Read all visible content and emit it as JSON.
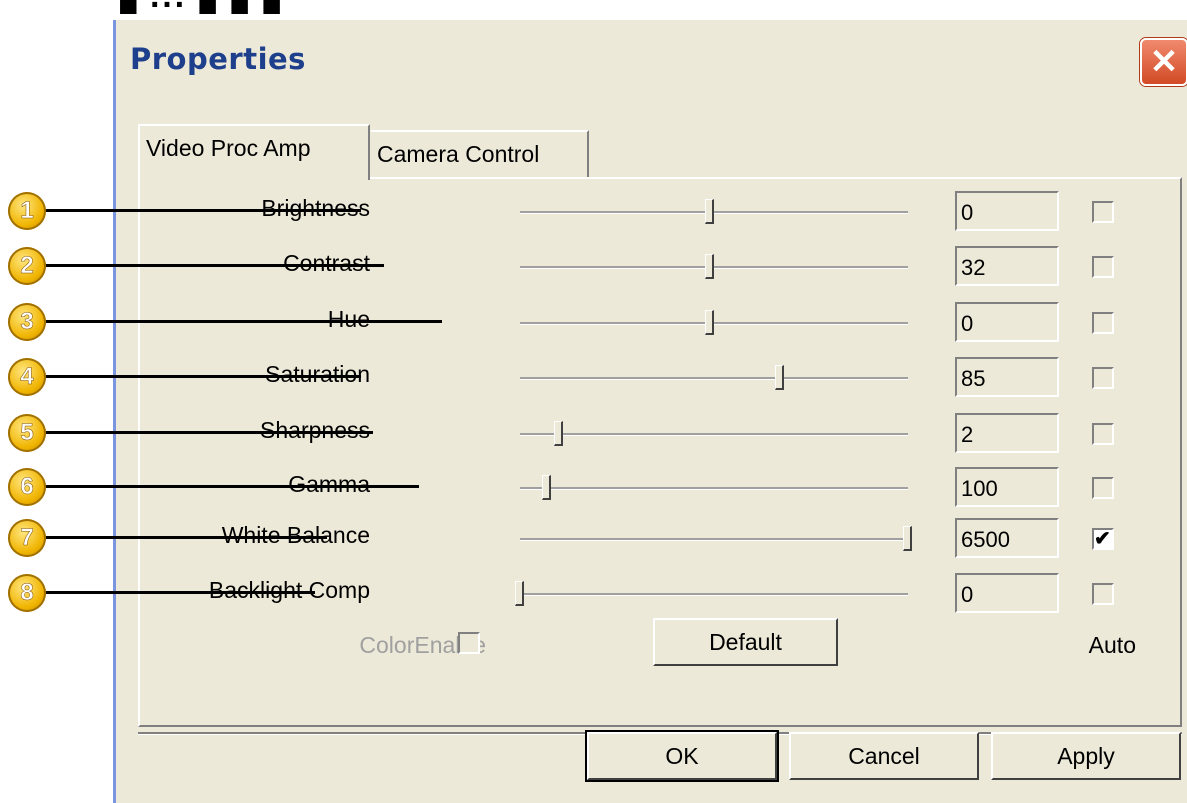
{
  "window": {
    "title": "Properties",
    "close_glyph": "✕"
  },
  "tabs": [
    {
      "label": "Video Proc Amp",
      "active": true
    },
    {
      "label": "Camera Control",
      "active": false
    }
  ],
  "controls": [
    {
      "callout": "1",
      "label": "Brightness",
      "value": "0",
      "auto": false,
      "slider_fraction": 0.49
    },
    {
      "callout": "2",
      "label": "Contrast",
      "value": "32",
      "auto": false,
      "slider_fraction": 0.49
    },
    {
      "callout": "3",
      "label": "Hue",
      "value": "0",
      "auto": false,
      "slider_fraction": 0.49
    },
    {
      "callout": "4",
      "label": "Saturation",
      "value": "85",
      "auto": false,
      "slider_fraction": 0.67
    },
    {
      "callout": "5",
      "label": "Sharpness",
      "value": "2",
      "auto": false,
      "slider_fraction": 0.1
    },
    {
      "callout": "6",
      "label": "Gamma",
      "value": "100",
      "auto": false,
      "slider_fraction": 0.07
    },
    {
      "callout": "7",
      "label": "White Balance",
      "value": "6500",
      "auto": true,
      "slider_fraction": 1.0
    },
    {
      "callout": "8",
      "label": "Backlight Comp",
      "value": "0",
      "auto": false,
      "slider_fraction": 0.0
    }
  ],
  "color_enable_label": "ColorEnable",
  "default_button": "Default",
  "auto_label": "Auto",
  "buttons": {
    "ok": "OK",
    "cancel": "Cancel",
    "apply": "Apply"
  },
  "colors": {
    "window_bg": "#ece9d8",
    "title_text": "#1e3f8c",
    "close_bg": "#d24a25",
    "callout": "#f0b400"
  }
}
